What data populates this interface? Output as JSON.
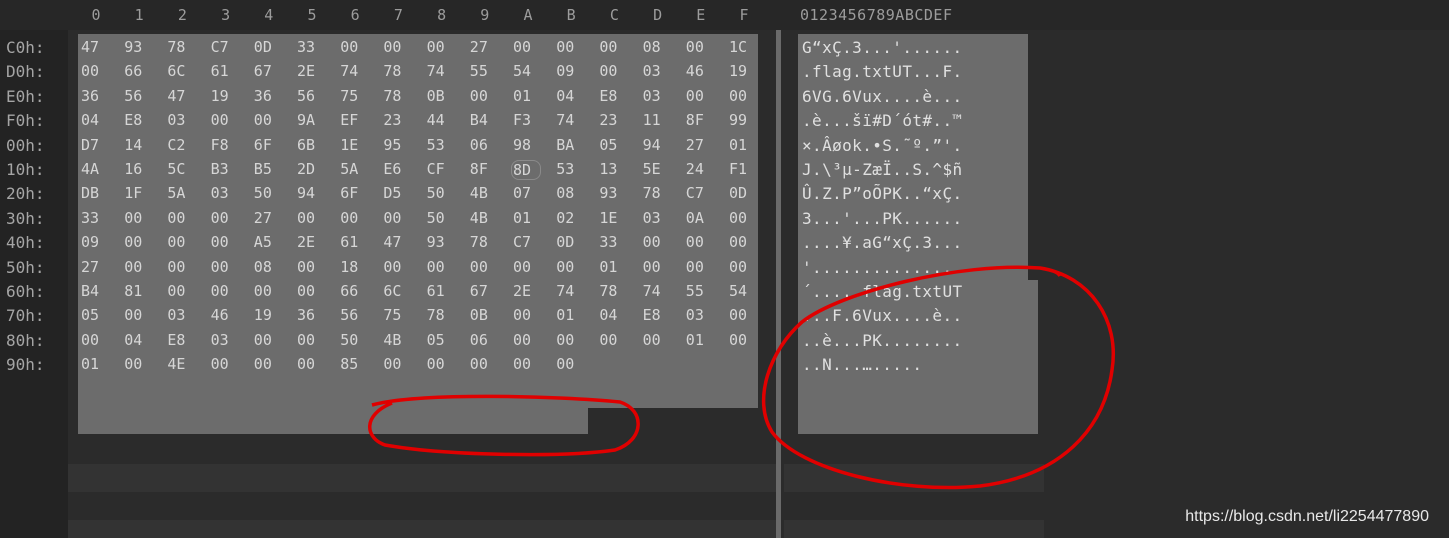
{
  "header": {
    "columns": [
      "0",
      "1",
      "2",
      "3",
      "4",
      "5",
      "6",
      "7",
      "8",
      "9",
      "A",
      "B",
      "C",
      "D",
      "E",
      "F"
    ],
    "ascii_header": "0123456789ABCDEF"
  },
  "rows": [
    {
      "offset": "C0h:",
      "hex": [
        "47",
        "93",
        "78",
        "C7",
        "0D",
        "33",
        "00",
        "00",
        "00",
        "27",
        "00",
        "00",
        "00",
        "08",
        "00",
        "1C"
      ],
      "ascii": "G“xÇ.3...'......"
    },
    {
      "offset": "D0h:",
      "hex": [
        "00",
        "66",
        "6C",
        "61",
        "67",
        "2E",
        "74",
        "78",
        "74",
        "55",
        "54",
        "09",
        "00",
        "03",
        "46",
        "19"
      ],
      "ascii": ".flag.txtUT...F."
    },
    {
      "offset": "E0h:",
      "hex": [
        "36",
        "56",
        "47",
        "19",
        "36",
        "56",
        "75",
        "78",
        "0B",
        "00",
        "01",
        "04",
        "E8",
        "03",
        "00",
        "00"
      ],
      "ascii": "6VG.6Vux....è..."
    },
    {
      "offset": "F0h:",
      "hex": [
        "04",
        "E8",
        "03",
        "00",
        "00",
        "9A",
        "EF",
        "23",
        "44",
        "B4",
        "F3",
        "74",
        "23",
        "11",
        "8F",
        "99"
      ],
      "ascii": ".è...šï#D´ót#..™"
    },
    {
      "offset": "00h:",
      "hex": [
        "D7",
        "14",
        "C2",
        "F8",
        "6F",
        "6B",
        "1E",
        "95",
        "53",
        "06",
        "98",
        "BA",
        "05",
        "94",
        "27",
        "01"
      ],
      "ascii": "×.Âøok.•S.˜º.”'."
    },
    {
      "offset": "10h:",
      "hex": [
        "4A",
        "16",
        "5C",
        "B3",
        "B5",
        "2D",
        "5A",
        "E6",
        "CF",
        "8F",
        "8D",
        "53",
        "13",
        "5E",
        "24",
        "F1"
      ],
      "ascii": "J.\\³µ-ZæÏ..S.^$ñ"
    },
    {
      "offset": "20h:",
      "hex": [
        "DB",
        "1F",
        "5A",
        "03",
        "50",
        "94",
        "6F",
        "D5",
        "50",
        "4B",
        "07",
        "08",
        "93",
        "78",
        "C7",
        "0D"
      ],
      "ascii": "Û.Z.P”oÕPK..“xÇ."
    },
    {
      "offset": "30h:",
      "hex": [
        "33",
        "00",
        "00",
        "00",
        "27",
        "00",
        "00",
        "00",
        "50",
        "4B",
        "01",
        "02",
        "1E",
        "03",
        "0A",
        "00"
      ],
      "ascii": "3...'...PK......"
    },
    {
      "offset": "40h:",
      "hex": [
        "09",
        "00",
        "00",
        "00",
        "A5",
        "2E",
        "61",
        "47",
        "93",
        "78",
        "C7",
        "0D",
        "33",
        "00",
        "00",
        "00"
      ],
      "ascii": "....¥.aG“xÇ.3..."
    },
    {
      "offset": "50h:",
      "hex": [
        "27",
        "00",
        "00",
        "00",
        "08",
        "00",
        "18",
        "00",
        "00",
        "00",
        "00",
        "00",
        "01",
        "00",
        "00",
        "00"
      ],
      "ascii": "'..............."
    },
    {
      "offset": "60h:",
      "hex": [
        "B4",
        "81",
        "00",
        "00",
        "00",
        "00",
        "66",
        "6C",
        "61",
        "67",
        "2E",
        "74",
        "78",
        "74",
        "55",
        "54"
      ],
      "ascii": "´.....flag.txtUT"
    },
    {
      "offset": "70h:",
      "hex": [
        "05",
        "00",
        "03",
        "46",
        "19",
        "36",
        "56",
        "75",
        "78",
        "0B",
        "00",
        "01",
        "04",
        "E8",
        "03",
        "00"
      ],
      "ascii": "...F.6Vux....è.."
    },
    {
      "offset": "80h:",
      "hex": [
        "00",
        "04",
        "E8",
        "03",
        "00",
        "00",
        "50",
        "4B",
        "05",
        "06",
        "00",
        "00",
        "00",
        "00",
        "01",
        "00"
      ],
      "ascii": "..è...PK........"
    },
    {
      "offset": "90h:",
      "hex": [
        "01",
        "00",
        "4E",
        "00",
        "00",
        "00",
        "85",
        "00",
        "00",
        "00",
        "00",
        "00"
      ],
      "ascii": "..N...…....."
    }
  ],
  "watermark": "https://blog.csdn.net/li2254477890",
  "colors": {
    "background": "#2b2b2b",
    "selection": "#6c6c6c",
    "annotation": "#e00000",
    "text": "#d6d6d6"
  }
}
